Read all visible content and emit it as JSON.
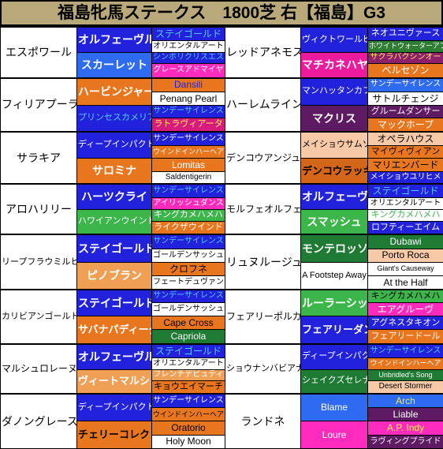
{
  "header": {
    "title": "福島牝馬ステークス　1800芝 右【福島】G3",
    "bg": "#b9a97a"
  },
  "table": {
    "rows": [
      {
        "left": {
          "name": "エスポワール",
          "bg": "#ffffff",
          "fg": "#000000",
          "sire": {
            "label": "オルフェーヴル",
            "bg": "#2222dd",
            "fg": "#ffffff"
          },
          "dam": {
            "label": "スカーレット",
            "bg": "#2e6bf0",
            "fg": "#ffffff"
          },
          "gp": [
            {
              "label": "ステイゴールド",
              "bg": "#2222dd",
              "fg": "#55ccff"
            },
            {
              "label": "オリエンタルアート",
              "bg": "#ffffff",
              "fg": "#000000"
            },
            {
              "label": "シンボリクリスエス",
              "bg": "#2222dd",
              "fg": "#55ccff"
            },
            {
              "label": "グレースアドマイヤ",
              "bg": "#ff2bbd",
              "fg": "#ffffff"
            }
          ]
        },
        "right": {
          "name": "レッドアネモス",
          "bg": "#ffffff",
          "fg": "#000000",
          "sire": {
            "label": "ヴィクトワールピサ",
            "bg": "#2222dd",
            "fg": "#ffffff"
          },
          "dam": {
            "label": "マチカネハヤテ",
            "bg": "#ee1a9e",
            "fg": "#ffffff"
          },
          "gp": [
            {
              "label": "ネオユニヴァース",
              "bg": "#2222dd",
              "fg": "#ffffff"
            },
            {
              "label": "ホワイトウォーターアフェア",
              "bg": "#2d7d32",
              "fg": "#ffffff"
            },
            {
              "label": "サクラバクシンオー",
              "bg": "#8e1f6b",
              "fg": "#ffee55"
            },
            {
              "label": "ベルセゾン",
              "bg": "#e8761e",
              "fg": "#ffffff"
            }
          ]
        }
      },
      {
        "left": {
          "name": "フィリアプーラ",
          "bg": "#ffffff",
          "fg": "#000000",
          "sire": {
            "label": "ハービンジャー",
            "bg": "#e8761e",
            "fg": "#ffffff"
          },
          "dam": {
            "label": "プリンセスカメリア",
            "bg": "#2222dd",
            "fg": "#55ccff"
          },
          "gp": [
            {
              "label": "Dansili",
              "bg": "#e8761e",
              "fg": "#2222dd"
            },
            {
              "label": "Penang Pearl",
              "bg": "#ffffff",
              "fg": "#000000"
            },
            {
              "label": "サンデーサイレンス",
              "bg": "#2222dd",
              "fg": "#55ccff"
            },
            {
              "label": "ラトラヴィアータ",
              "bg": "#d61a7e",
              "fg": "#ffee55"
            }
          ]
        },
        "right": {
          "name": "ハーレムライン",
          "bg": "#ffffff",
          "fg": "#000000",
          "sire": {
            "label": "マンハッタンカフェ",
            "bg": "#2222dd",
            "fg": "#ffffff"
          },
          "dam": {
            "label": "マクリス",
            "bg": "#5e1a63",
            "fg": "#ffffff"
          },
          "gp": [
            {
              "label": "サンデーサイレンス",
              "bg": "#2e6bf0",
              "fg": "#ffffff"
            },
            {
              "label": "サトルチェンジ",
              "bg": "#ffffff",
              "fg": "#000000"
            },
            {
              "label": "グルームダンサー",
              "bg": "#5e1a63",
              "fg": "#ffffff"
            },
            {
              "label": "マックホープ",
              "bg": "#e8761e",
              "fg": "#ffffff"
            }
          ]
        }
      },
      {
        "left": {
          "name": "サラキア",
          "bg": "#ffffff",
          "fg": "#000000",
          "sire": {
            "label": "ディープインパクト",
            "bg": "#2222dd",
            "fg": "#ffffff"
          },
          "dam": {
            "label": "サロミナ",
            "bg": "#e8761e",
            "fg": "#ffffff"
          },
          "gp": [
            {
              "label": "サンデーサイレンス",
              "bg": "#2222dd",
              "fg": "#ffffff"
            },
            {
              "label": "ウインドインハーヘア",
              "bg": "#e8761e",
              "fg": "#ffffff"
            },
            {
              "label": "Lomitas",
              "bg": "#e8761e",
              "fg": "#ffffff"
            },
            {
              "label": "Saldentigerin",
              "bg": "#ffffff",
              "fg": "#000000"
            }
          ]
        },
        "right": {
          "name": "デンコウアンジュ",
          "bg": "#ffffff",
          "fg": "#000000",
          "sire": {
            "label": "メイショウサムソン",
            "bg": "#f7c9a6",
            "fg": "#000000"
          },
          "dam": {
            "label": "デンコウラッキー",
            "bg": "#d4661a",
            "fg": "#000000"
          },
          "gp": [
            {
              "label": "オペラハウス",
              "bg": "#f7c9a6",
              "fg": "#000000"
            },
            {
              "label": "マイヴィヴィアン",
              "bg": "#e8761e",
              "fg": "#000000"
            },
            {
              "label": "マリエンバード",
              "bg": "#e8761e",
              "fg": "#000000"
            },
            {
              "label": "メイショウユリヒメ",
              "bg": "#2222dd",
              "fg": "#ffffff"
            }
          ]
        }
      },
      {
        "left": {
          "name": "アロハリリー",
          "bg": "#ffffff",
          "fg": "#000000",
          "sire": {
            "label": "ハーツクライ",
            "bg": "#2222dd",
            "fg": "#ffffff"
          },
          "dam": {
            "label": "ハワイアンウインド",
            "bg": "#3cb54a",
            "fg": "#ffffff"
          },
          "gp": [
            {
              "label": "サンデーサイレンス",
              "bg": "#2222dd",
              "fg": "#55ccff"
            },
            {
              "label": "アイリッシュダンス",
              "bg": "#ff2bbd",
              "fg": "#ffffff"
            },
            {
              "label": "キングカメハメハ",
              "bg": "#3cb54a",
              "fg": "#ffffff"
            },
            {
              "label": "ライクザウインド",
              "bg": "#e8761e",
              "fg": "#ffffff"
            }
          ]
        },
        "right": {
          "name": "モルフェオルフェ",
          "bg": "#ffffff",
          "fg": "#000000",
          "sire": {
            "label": "オルフェーヴル",
            "bg": "#2222dd",
            "fg": "#ffffff"
          },
          "dam": {
            "label": "スマッシュ",
            "bg": "#3cb54a",
            "fg": "#ffffff"
          },
          "gp": [
            {
              "label": "ステイゴールド",
              "bg": "#2222dd",
              "fg": "#55ccff"
            },
            {
              "label": "オリエンタルアート",
              "bg": "#ffffff",
              "fg": "#000000"
            },
            {
              "label": "キングカメハメハ",
              "bg": "#ffffff",
              "fg": "#3cb54a"
            },
            {
              "label": "ロフティーエイム",
              "bg": "#2222dd",
              "fg": "#ffffff"
            }
          ]
        }
      },
      {
        "left": {
          "name": "リープフラウミルヒ",
          "bg": "#ffffff",
          "fg": "#000000",
          "sire": {
            "label": "ステイゴールド",
            "bg": "#2222dd",
            "fg": "#ffffff"
          },
          "dam": {
            "label": "ピノブラン",
            "bg": "#f0a055",
            "fg": "#ffffff"
          },
          "gp": [
            {
              "label": "サンデーサイレンス",
              "bg": "#2222dd",
              "fg": "#55ccff"
            },
            {
              "label": "ゴールデンサッシュ",
              "bg": "#ffffff",
              "fg": "#000000"
            },
            {
              "label": "クロフネ",
              "bg": "#e8761e",
              "fg": "#000000"
            },
            {
              "label": "フェートデュヴァン",
              "bg": "#ffffff",
              "fg": "#000000"
            }
          ]
        },
        "right": {
          "name": "リュヌルージュ",
          "bg": "#ffffff",
          "fg": "#000000",
          "sire": {
            "label": "モンテロッソ",
            "bg": "#1f7a33",
            "fg": "#ffffff"
          },
          "dam": {
            "label": "A Footstep Away",
            "bg": "#ffffff",
            "fg": "#000000"
          },
          "gp": [
            {
              "label": "Dubawi",
              "bg": "#1f7a33",
              "fg": "#ffffff"
            },
            {
              "label": "Porto Roca",
              "bg": "#f7c9a6",
              "fg": "#000000"
            },
            {
              "label": "Giant's Causeway",
              "bg": "#ffffff",
              "fg": "#000000"
            },
            {
              "label": "At the Half",
              "bg": "#ffffff",
              "fg": "#000000"
            }
          ]
        }
      },
      {
        "left": {
          "name": "カリビアンゴールド",
          "bg": "#ffffff",
          "fg": "#000000",
          "sire": {
            "label": "ステイゴールド",
            "bg": "#2222dd",
            "fg": "#ffffff"
          },
          "dam": {
            "label": "サバナパディーダ",
            "bg": "#e8761e",
            "fg": "#ffffff"
          },
          "gp": [
            {
              "label": "サンデーサイレンス",
              "bg": "#2222dd",
              "fg": "#55ccff"
            },
            {
              "label": "ゴールデンサッシュ",
              "bg": "#ffffff",
              "fg": "#000000"
            },
            {
              "label": "Cape Cross",
              "bg": "#e8761e",
              "fg": "#000000"
            },
            {
              "label": "Capriola",
              "bg": "#1f7a33",
              "fg": "#ffffff"
            }
          ]
        },
        "right": {
          "name": "フェアリーポルカ",
          "bg": "#ffffff",
          "fg": "#000000",
          "sire": {
            "label": "ルーラーシップ",
            "bg": "#3cb54a",
            "fg": "#ffffff"
          },
          "dam": {
            "label": "フェアリーダンス",
            "bg": "#2222dd",
            "fg": "#ffffff"
          },
          "gp": [
            {
              "label": "キングカメハメハ",
              "bg": "#3cb54a",
              "fg": "#000000"
            },
            {
              "label": "エアグルーヴ",
              "bg": "#ff2bbd",
              "fg": "#ffffff"
            },
            {
              "label": "アグネスタキオン",
              "bg": "#2222dd",
              "fg": "#ffffff"
            },
            {
              "label": "フェアリードール",
              "bg": "#e8761e",
              "fg": "#ffffff"
            }
          ]
        }
      },
      {
        "left": {
          "name": "マルシュロレーヌ",
          "bg": "#ffffff",
          "fg": "#000000",
          "sire": {
            "label": "オルフェーヴル",
            "bg": "#2222dd",
            "fg": "#ffffff"
          },
          "dam": {
            "label": "ヴィートマルシェ",
            "bg": "#f0a055",
            "fg": "#ffffff"
          },
          "gp": [
            {
              "label": "ステイゴールド",
              "bg": "#2222dd",
              "fg": "#55ccff"
            },
            {
              "label": "オリエンタルアート",
              "bg": "#ffffff",
              "fg": "#000000"
            },
            {
              "label": "フレンチデピュティ",
              "bg": "#f0a055",
              "fg": "#ffffff"
            },
            {
              "label": "キョウエイマーチ",
              "bg": "#e8761e",
              "fg": "#000000"
            }
          ]
        },
        "right": {
          "name": "ショウナンバビアナ",
          "bg": "#ffffff",
          "fg": "#000000",
          "sire": {
            "label": "ディープインパクト",
            "bg": "#2222dd",
            "fg": "#ffffff"
          },
          "dam": {
            "label": "シェイクズセレナーデ",
            "bg": "#1f7a33",
            "fg": "#ffffff"
          },
          "gp": [
            {
              "label": "サンデーサイレンス",
              "bg": "#2222dd",
              "fg": "#55ccff"
            },
            {
              "label": "ウインドインハーヘア",
              "bg": "#e8761e",
              "fg": "#ffffff"
            },
            {
              "label": "Unbridled's Song",
              "bg": "#1f7a33",
              "fg": "#ffffff"
            },
            {
              "label": "Desert Stormer",
              "bg": "#f7c9a6",
              "fg": "#000000"
            }
          ]
        }
      },
      {
        "left": {
          "name": "ダノングレース",
          "bg": "#ffffff",
          "fg": "#000000",
          "sire": {
            "label": "ディープインパクト",
            "bg": "#2222dd",
            "fg": "#ffffff"
          },
          "dam": {
            "label": "チェリーコレクト",
            "bg": "#e8761e",
            "fg": "#000000"
          },
          "gp": [
            {
              "label": "サンデーサイレンス",
              "bg": "#2222dd",
              "fg": "#ffffff"
            },
            {
              "label": "ウインドインハーヘア",
              "bg": "#e8761e",
              "fg": "#000000"
            },
            {
              "label": "Oratorio",
              "bg": "#e8761e",
              "fg": "#000000"
            },
            {
              "label": "Holy Moon",
              "bg": "#ffffff",
              "fg": "#000000"
            }
          ]
        },
        "right": {
          "name": "ランドネ",
          "bg": "#ffffff",
          "fg": "#000000",
          "sire": {
            "label": "Blame",
            "bg": "#2e6bf0",
            "fg": "#ffffff"
          },
          "dam": {
            "label": "Loure",
            "bg": "#ff2bbd",
            "fg": "#ffffff"
          },
          "gp": [
            {
              "label": "Arch",
              "bg": "#2e6bf0",
              "fg": "#ffee55"
            },
            {
              "label": "Liable",
              "bg": "#5e1a63",
              "fg": "#ffffff"
            },
            {
              "label": "A.P. Indy",
              "bg": "#ff2bbd",
              "fg": "#ffee55"
            },
            {
              "label": "ラヴィングプライド",
              "bg": "#5e1a63",
              "fg": "#ffffff"
            }
          ]
        }
      }
    ]
  }
}
